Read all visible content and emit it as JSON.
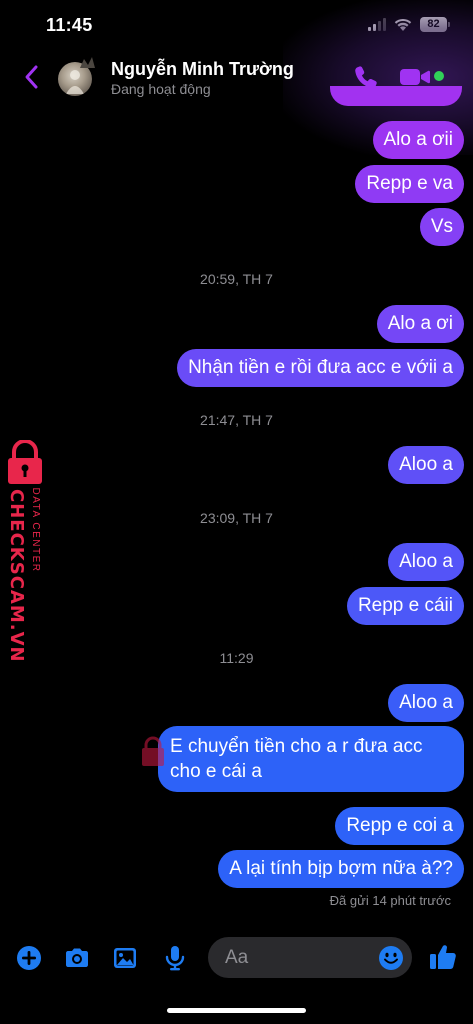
{
  "status_bar": {
    "time": "11:45",
    "battery": "82"
  },
  "header": {
    "contact_name": "Nguyễn Minh Trường",
    "contact_status": "Đang hoạt động",
    "icons": [
      "back-chevron-icon",
      "phone-icon",
      "video-camera-icon"
    ]
  },
  "messages": [
    {
      "type": "sent",
      "text": "Alo a ơii"
    },
    {
      "type": "sent",
      "text": "Repp e va"
    },
    {
      "type": "sent",
      "text": "Vs"
    },
    {
      "type": "time",
      "text": "20:59, TH 7"
    },
    {
      "type": "sent",
      "text": "Alo a ơi"
    },
    {
      "type": "sent",
      "text": "Nhận tiền e rồi đưa acc e vớii a"
    },
    {
      "type": "time",
      "text": "21:47, TH 7"
    },
    {
      "type": "sent",
      "text": "Aloo a"
    },
    {
      "type": "time",
      "text": "23:09, TH 7"
    },
    {
      "type": "sent",
      "text": "Aloo a"
    },
    {
      "type": "sent",
      "text": "Repp e cáii"
    },
    {
      "type": "time",
      "text": "11:29"
    },
    {
      "type": "sent",
      "text": "Aloo a"
    },
    {
      "type": "sent",
      "text": "E chuyển tiền cho a r đưa acc cho e cái a"
    },
    {
      "type": "sent",
      "text": "Repp e coi a"
    },
    {
      "type": "sent",
      "text": "A lại tính bịp bợm nữa à??"
    }
  ],
  "delivery_status": "Đã gửi 14 phút trước",
  "watermark": {
    "brand": "CHECKSCAM.VN",
    "sub": "DATA CENTER"
  },
  "composer": {
    "placeholder": "Aa",
    "icons": [
      "add-icon",
      "camera-icon",
      "image-icon",
      "microphone-icon",
      "emoji-icon",
      "thumbs-up-icon"
    ]
  },
  "colors": {
    "bubble_gradient": [
      "#a232f0",
      "#8a3ef5",
      "#6a4ef8",
      "#3e5cf8",
      "#2d62f8"
    ],
    "accent": "#a033f2",
    "composer_icon": "#1e7cf2"
  }
}
